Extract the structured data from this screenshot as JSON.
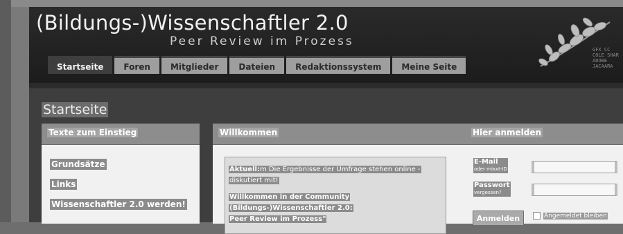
{
  "site": {
    "title": "(Bildungs-)Wissenschaftler 2.0",
    "subtitle": "Peer Review im Prozess",
    "logo_text": "GFX CC\nCOLE SHAR\nADOBE\nJACAARA"
  },
  "nav": {
    "items": [
      {
        "label": "Startseite",
        "active": true
      },
      {
        "label": "Foren",
        "active": false
      },
      {
        "label": "Mitglieder",
        "active": false
      },
      {
        "label": "Dateien",
        "active": false
      },
      {
        "label": "Redaktionssystem",
        "active": false
      },
      {
        "label": "Meine Seite",
        "active": false
      }
    ]
  },
  "main": {
    "page_title": "Startseite"
  },
  "panels": {
    "intro": {
      "title": "Texte zum Einstieg",
      "links": [
        "Grundsätze",
        "Links",
        "Wissenschaftler 2.0 werden!"
      ]
    },
    "welcome": {
      "title": "Willkommen",
      "news_label": "Aktuell:",
      "news_text": "m Die Ergebnisse der Umfrage stehen online -",
      "news_text2": "diskutiert mit!",
      "welcome_line1": "Willkommen in der Community",
      "welcome_line2": "(Bildungs-)Wissenschaftler 2.0:",
      "welcome_line3": "Peer Review im Prozess\""
    },
    "login": {
      "title": "Hier anmelden",
      "email_label": "E-Mail",
      "email_sub": "oder mixxt-ID",
      "password_label": "Passwort",
      "password_sub": "vergessen?",
      "submit_label": "Anmelden",
      "remember_label": "Angemeldet bleiben"
    }
  }
}
